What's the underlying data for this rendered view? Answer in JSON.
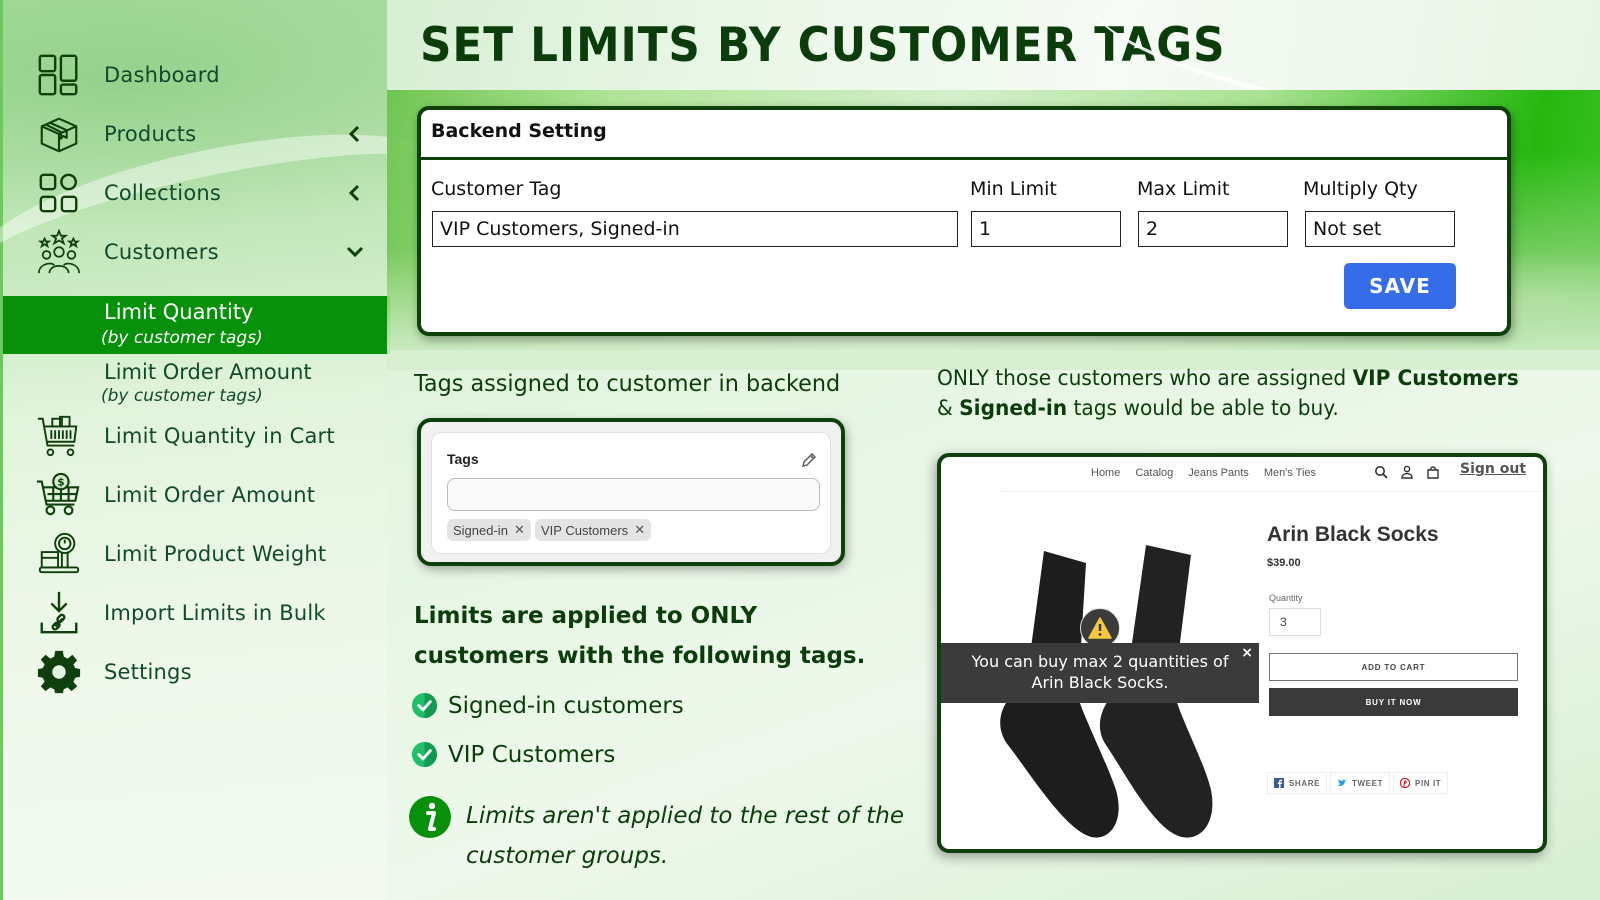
{
  "header": {
    "title": "SET LIMITS BY CUSTOMER TAGS"
  },
  "sidebar": {
    "items": [
      {
        "label": "Dashboard",
        "icon": "dashboard-icon",
        "expandable": false
      },
      {
        "label": "Products",
        "icon": "box-icon",
        "expandable": true,
        "state": "collapsed"
      },
      {
        "label": "Collections",
        "icon": "collections-icon",
        "expandable": true,
        "state": "collapsed"
      },
      {
        "label": "Customers",
        "icon": "customers-icon",
        "expandable": true,
        "state": "expanded"
      }
    ],
    "sub_items": [
      {
        "label": "Limit Quantity",
        "sublabel": "(by customer tags)",
        "active": true
      },
      {
        "label": "Limit Order Amount",
        "sublabel": "(by customer tags)",
        "active": false
      }
    ],
    "items_after": [
      {
        "label": "Limit Quantity in Cart",
        "icon": "cart-icon"
      },
      {
        "label": "Limit Order Amount",
        "icon": "cart-dollar-icon"
      },
      {
        "label": "Limit Product Weight",
        "icon": "weight-scale-icon"
      },
      {
        "label": "Import Limits in Bulk",
        "icon": "import-icon"
      },
      {
        "label": "Settings",
        "icon": "gear-icon"
      }
    ]
  },
  "backend": {
    "title": "Backend Setting",
    "fields": {
      "customer_tag": {
        "label": "Customer Tag",
        "value": "VIP Customers, Signed-in"
      },
      "min_limit": {
        "label": "Min Limit",
        "value": "1"
      },
      "max_limit": {
        "label": "Max Limit",
        "value": "2"
      },
      "multiply_qty": {
        "label": "Multiply Qty",
        "value": "Not set"
      }
    },
    "save_label": "SAVE"
  },
  "tags_panel": {
    "caption": "Tags assigned to customer in backend",
    "title": "Tags",
    "input_value": "",
    "chips": [
      "Signed-in",
      "VIP Customers"
    ]
  },
  "limits": {
    "heading": "Limits are applied to ONLY customers with the following tags.",
    "items": [
      "Signed-in customers",
      "VIP Customers"
    ],
    "note": "Limits aren't applied to the rest of the customer groups."
  },
  "only_note": {
    "prefix": "ONLY those customers who are assigned ",
    "tag1": "VIP Customers",
    "mid": " & ",
    "tag2": "Signed-in",
    "suffix": " tags would be able to buy."
  },
  "store": {
    "nav": [
      "Home",
      "Catalog",
      "Jeans Pants",
      "Men's Ties"
    ],
    "sign_out": "Sign out",
    "product": {
      "title": "Arin Black Socks",
      "price": "$39.00",
      "quantity_label": "Quantity",
      "quantity": "3",
      "add_to_cart": "ADD TO CART",
      "buy_now": "BUY IT NOW"
    },
    "share": [
      "SHARE",
      "TWEET",
      "PIN IT"
    ],
    "toast": {
      "line1": "You can buy max 2 quantities of",
      "line2": "Arin Black Socks.",
      "close": "×"
    }
  },
  "colors": {
    "accent_green": "#07900a",
    "dark_green": "#0b3d0b",
    "save_blue": "#356de8",
    "check_green": "#1fbf6a"
  }
}
